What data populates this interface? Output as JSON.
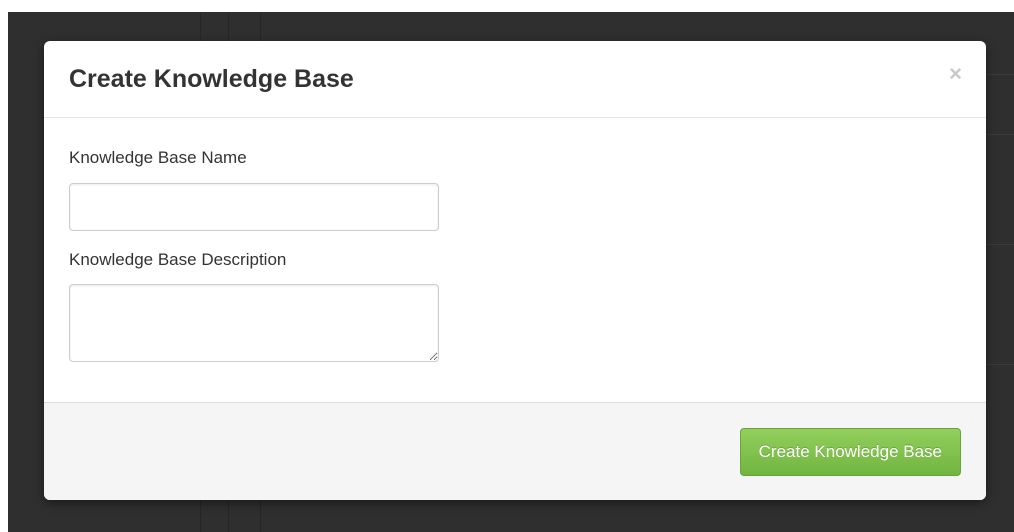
{
  "modal": {
    "title": "Create Knowledge Base",
    "close_glyph": "×",
    "close_icon": "close-icon"
  },
  "form": {
    "name_label": "Knowledge Base Name",
    "name_value": "",
    "name_placeholder": "",
    "description_label": "Knowledge Base Description",
    "description_value": "",
    "description_placeholder": ""
  },
  "footer": {
    "submit_label": "Create Knowledge Base"
  },
  "colors": {
    "backdrop": "#2f2f2f",
    "primary_button": "#7fc04a",
    "title_text": "#333333",
    "footer_bg": "#f5f5f5"
  }
}
